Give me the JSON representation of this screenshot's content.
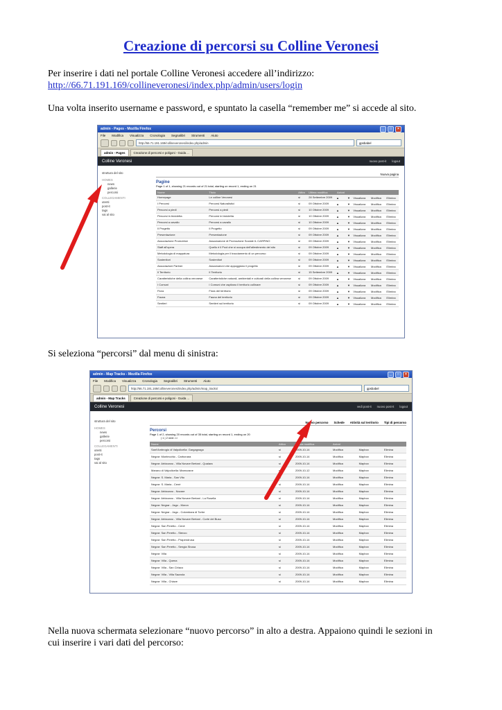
{
  "doc": {
    "title": "Creazione di percorsi su Colline Veronesi",
    "p1_line1": "Per inserire i dati nel portale Colline Veronesi accedere all’indirizzo:",
    "p1_link": "http://66.71.191.169/collineveronesi/index.php/admin/users/login",
    "p2": "Una volta inserito username e password, e spuntato la casella “remember me” si accede al sito.",
    "p3": "Si seleziona “percorsi” dal menu di sinistra:",
    "p4_line1": "Nella nuova schermata selezionare “nuovo percorso” in alto a destra. Appaiono quindi le sezioni in",
    "p4_line2": "cui inserire i vari dati del percorso:"
  },
  "browser_menu": [
    "File",
    "Modifica",
    "Visualizza",
    "Cronologia",
    "Segnalibri",
    "Strumenti",
    "Aiuto"
  ],
  "shot1": {
    "window_title": "admin - Pages - Mozilla Firefox",
    "url": "http://66.71.191.169/collineveronesi/index.php/admin",
    "search": "gpsbabel",
    "tab1": "admin - Pages",
    "tab2": "Creazione di percorsi e poligoni - Guida ...",
    "app_title": "Colline Veronesi",
    "hdr_links": [
      "nuovo post-it",
      "logout"
    ],
    "side_top": "struttura del sito",
    "side_section": "HOMES",
    "side_items": [
      "news",
      "gallerie",
      "percorsi"
    ],
    "side_section2": "COLLEGAMENTI",
    "side_items2": [
      "utenti",
      "post-it",
      "tags",
      "vai al sito"
    ],
    "new_page": "Nuova pagina",
    "section_title": "Pagine",
    "section_info": "Page 1 of 1, showing 21 records out of 21 total, starting on record 1, ending on 21",
    "columns": [
      "Nome",
      "Titolo",
      "Attivo",
      "Ultima modifica",
      "Azioni",
      "",
      "",
      "",
      ""
    ],
    "rows": [
      [
        "Homepage",
        "Le colline Veronesi",
        "si",
        "28 Settembre 2009"
      ],
      [
        "I Percorsi",
        "Percorsi Naturalistici",
        "si",
        "09 Ottobre 2009"
      ],
      [
        "Percorsi a piedi",
        "Percorsi a piedi",
        "si",
        "10 Ottobre 2009"
      ],
      [
        "Percorsi in bicicletta",
        "Percorsi in bicicletta",
        "si",
        "10 Ottobre 2009"
      ],
      [
        "Percorsi a cavallo",
        "Percorsi a cavallo",
        "si",
        "10 Ottobre 2009"
      ],
      [
        "Il Progetto",
        "Il Progetto",
        "si",
        "09 Ottobre 2009"
      ],
      [
        "Presentazione",
        "Presentazione",
        "si",
        "09 Ottobre 2009"
      ],
      [
        "Associazione Promotrice",
        "Associazione di Promozione Sociale IL CARPINO",
        "si",
        "09 Ottobre 2009"
      ],
      [
        "Staff all'opera",
        "Quello è il Pool che si occupa dell'allestimento del sito",
        "si",
        "09 Ottobre 2009"
      ],
      [
        "Metodologia di mappatura",
        "Metodologia per il tracciamento di un percorso",
        "si",
        "09 Ottobre 2009"
      ],
      [
        "Sostenitori",
        "Sostenitori",
        "si",
        "09 Ottobre 2009"
      ],
      [
        "Associazioni Partner",
        "Associazioni che appoggiano il progetto",
        "si",
        "09 Ottobre 2009"
      ],
      [
        "Il Territorio",
        "Il Territorio",
        "si",
        "15 Settembre 2009"
      ],
      [
        "Caratteristiche della collina veronese",
        "Caratteristiche naturali, ambientali e culturali della collina veronese",
        "si",
        "09 Ottobre 2009"
      ],
      [
        "I Comuni",
        "I Comuni che ospitano il territorio collinare",
        "si",
        "09 Ottobre 2009"
      ],
      [
        "Flora",
        "Flora del territorio",
        "si",
        "09 Ottobre 2009"
      ],
      [
        "Fauna",
        "Fauna del territorio",
        "si",
        "09 Ottobre 2009"
      ],
      [
        "Sentieri",
        "Sentieri sul territorio",
        "si",
        "09 Ottobre 2009"
      ]
    ],
    "actions": [
      "Visualizza",
      "Modifica",
      "Elimina"
    ]
  },
  "shot2": {
    "window_title": "admin - Map Tracks - Mozilla Firefox",
    "url": "http://66.71.191.169/collineveronesi/index.php/admin/map_tracks/",
    "search": "gpsbabel",
    "tab1": "admin - Map Tracks",
    "tab2": "Creazione di percorsi e poligoni - Guida ...",
    "app_title": "Colline Veronesi",
    "hdr_links": [
      "vedi post-it",
      "nuovo post-it",
      "logout"
    ],
    "side_top": "struttura del sito",
    "side_section": "HOMES",
    "side_items": [
      "news",
      "gallerie",
      "percorsi"
    ],
    "side_section2": "COLLEGAMENTI",
    "side_items2": [
      "utenti",
      "post-it",
      "tags",
      "vai al sito"
    ],
    "top_links": [
      "Nuovo percorso",
      "Schede",
      "Attività sul territorio",
      "Tipi di percorso"
    ],
    "section_title": "Percorsi",
    "section_info": "Page 1 of 2, showing 20 records out of 35 total, starting on record 1, ending on 20",
    "pager": "| 1 | 2 next >>",
    "columns": [
      "Nome",
      "Attivo",
      "Ultima modifica",
      "Azioni",
      "",
      ""
    ],
    "rows": [
      [
        "Sant'Ambrogio di Valpolicella: Gargagnago",
        "si",
        "2009-10-14"
      ],
      [
        "Negrar: Montecchio - Carbonara",
        "si",
        "2009-10-14"
      ],
      [
        "Negrar: Arbizzano - Villa Novare Bertani - Quaiara",
        "si",
        "2009-10-14"
      ],
      [
        "Marano di Valpolicella: Marezzane",
        "si",
        "2009-10-12"
      ],
      [
        "Negrar: S. Maria - San Vito",
        "si",
        "2009-10-14"
      ],
      [
        "Negrar: S. Maria - Cenè",
        "si",
        "2009-10-14"
      ],
      [
        "Negrar: Arbizzano - Novare",
        "si",
        "2009-10-14"
      ],
      [
        "Negrar: Arbizzano - Villa Novare Bertani - La Rosella",
        "si",
        "2009-10-14"
      ],
      [
        "Negrar: Negrar - Jago - Moron",
        "si",
        "2009-10-14"
      ],
      [
        "Negrar: Negrar - Jago - Colombara di Torbe",
        "si",
        "2009-10-14"
      ],
      [
        "Negrar: Arbizzano - Villa Novare Bertani - Corte del Buso",
        "si",
        "2009-10-14"
      ],
      [
        "Negrar: San Peretto - Cenè",
        "si",
        "2009-10-14"
      ],
      [
        "Negrar: San Peretto - Stenzo",
        "si",
        "2009-10-14"
      ],
      [
        "Negrar: San Peretto - Prapendrusa",
        "si",
        "2009-10-14"
      ],
      [
        "Negrar: San Peretto - Sengia Sbusa",
        "si",
        "2009-10-14"
      ],
      [
        "Negrar: Villa",
        "si",
        "2009-10-14"
      ],
      [
        "Negrar: Villa - Quena",
        "si",
        "2009-10-14"
      ],
      [
        "Negrar: Villa - San Ciriaco",
        "si",
        "2009-10-14"
      ],
      [
        "Negrar: Villa - Villa Sazzola",
        "si",
        "2009-10-14"
      ],
      [
        "Negrar: Villa - Chiave",
        "si",
        "2009-10-14"
      ]
    ],
    "actions": [
      "Modifica",
      "Mapbox",
      "Elimina"
    ]
  },
  "colors": {
    "link": "#1f2cc9",
    "arrow": "#e01b1b",
    "section": "#2a4f9c"
  }
}
